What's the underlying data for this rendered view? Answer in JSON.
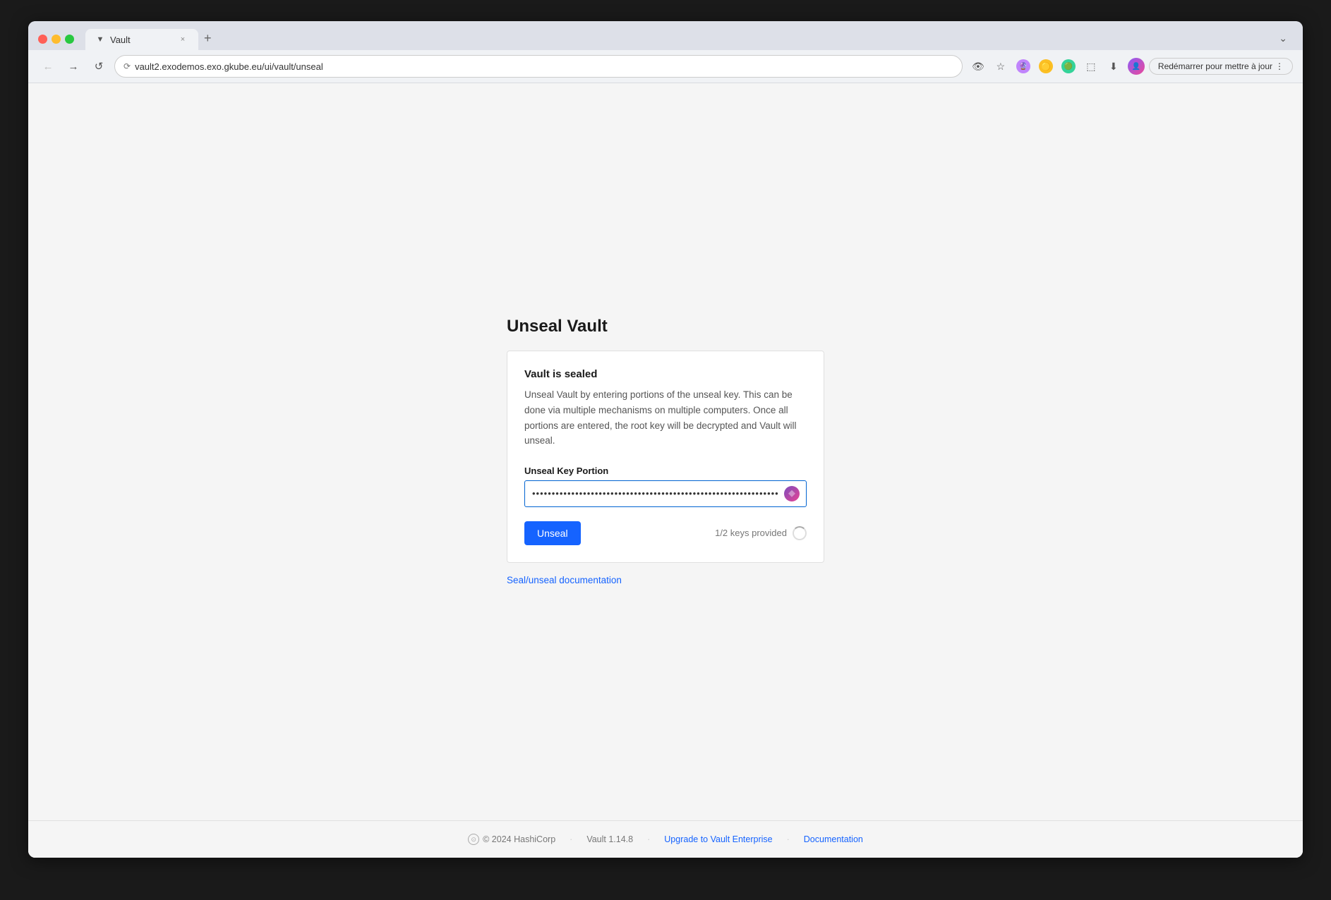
{
  "browser": {
    "tab": {
      "favicon": "▼",
      "title": "Vault",
      "close": "×"
    },
    "new_tab": "+",
    "dropdown": "⌄",
    "nav": {
      "back": "←",
      "forward": "→",
      "reload": "↺",
      "address": "vault2.exodemos.exo.gkube.eu/ui/vault/unseal",
      "address_icon": "⟳"
    },
    "restart_label": "Redémarrer pour mettre à jour"
  },
  "page": {
    "title": "Unseal Vault",
    "card": {
      "title": "Vault is sealed",
      "description": "Unseal Vault by entering portions of the unseal key. This can be done via multiple mechanisms on multiple computers. Once all portions are entered, the root key will be decrypted and Vault will unseal.",
      "field_label": "Unseal Key Portion",
      "input_placeholder": "········································································",
      "unseal_button": "Unseal",
      "keys_status": "1/2 keys provided"
    },
    "doc_link": "Seal/unseal documentation"
  },
  "footer": {
    "copyright": "© 2024 HashiCorp",
    "version": "Vault 1.14.8",
    "upgrade_link": "Upgrade to Vault Enterprise",
    "doc_link": "Documentation"
  }
}
